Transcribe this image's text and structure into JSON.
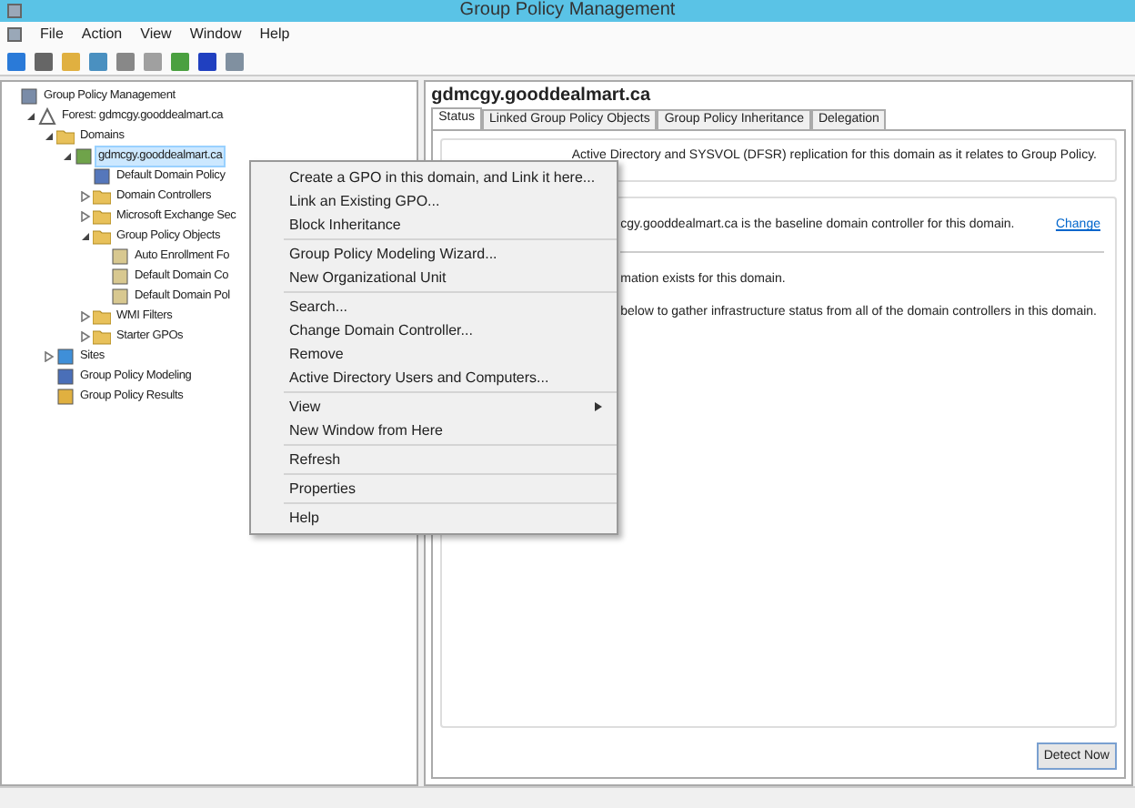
{
  "window": {
    "title": "Group Policy Management"
  },
  "menu_bar": [
    "File",
    "Action",
    "View",
    "Window",
    "Help"
  ],
  "tree": [
    {
      "label": "Group Policy Management",
      "kind": "root",
      "children": [
        {
          "label": "Forest: gdmcgy.gooddealmart.ca",
          "kind": "forest",
          "expanded": true,
          "children": [
            {
              "label": "Domains",
              "kind": "folder",
              "expanded": true,
              "children": [
                {
                  "label": "gdmcgy.gooddealmart.ca",
                  "kind": "domain",
                  "expanded": true,
                  "selected": true,
                  "children": [
                    {
                      "label": "Default Domain Policy",
                      "kind": "link",
                      "selected": false
                    },
                    {
                      "label": "Domain Controllers",
                      "kind": "folder",
                      "expanded": false,
                      "selected": false
                    },
                    {
                      "label": "Microsoft Exchange Sec",
                      "kind": "folder",
                      "expanded": false,
                      "selected": false
                    },
                    {
                      "label": "Group Policy Objects",
                      "kind": "folder",
                      "expanded": true,
                      "selected": false,
                      "children": [
                        {
                          "label": "Auto Enrollment Fo",
                          "kind": "gpo",
                          "selected": false
                        },
                        {
                          "label": "Default Domain Co",
                          "kind": "gpo",
                          "selected": false
                        },
                        {
                          "label": "Default Domain Pol",
                          "kind": "gpo",
                          "selected": false
                        }
                      ]
                    },
                    {
                      "label": "WMI Filters",
                      "kind": "folder",
                      "expanded": false,
                      "selected": false
                    },
                    {
                      "label": "Starter GPOs",
                      "kind": "folder",
                      "expanded": false,
                      "selected": false
                    }
                  ]
                }
              ]
            },
            {
              "label": "Sites",
              "kind": "sites",
              "expanded": false
            },
            {
              "label": "Group Policy Modeling",
              "kind": "modeling"
            },
            {
              "label": "Group Policy Results",
              "kind": "results"
            }
          ]
        }
      ]
    }
  ],
  "details": {
    "title": "gdmcgy.gooddealmart.ca",
    "tabs": [
      {
        "label": "Status",
        "selected": true
      },
      {
        "label": "Linked Group Policy Objects",
        "selected": false
      },
      {
        "label": "Group Policy Inheritance",
        "selected": false
      },
      {
        "label": "Delegation",
        "selected": false
      }
    ],
    "intro": "Active Directory and SYSVOL (DFSR) replication for this domain as it relates to Group Policy.",
    "baseline": "cgy.gooddealmart.ca is the baseline domain controller for this domain.",
    "change_link": "Change",
    "lines": [
      "mation exists for this domain.",
      "below to gather infrastructure status from all of the domain controllers in this domain."
    ],
    "detect_button": "Detect Now"
  },
  "context_menu": [
    [
      {
        "label": "Create a GPO in this domain, and Link it here..."
      },
      {
        "label": "Link an Existing GPO..."
      },
      {
        "label": "Block Inheritance"
      }
    ],
    [
      {
        "label": "Group Policy Modeling Wizard..."
      },
      {
        "label": "New Organizational Unit"
      }
    ],
    [
      {
        "label": "Search..."
      },
      {
        "label": "Change Domain Controller..."
      },
      {
        "label": "Remove"
      },
      {
        "label": "Active Directory Users and Computers..."
      }
    ],
    [
      {
        "label": "View",
        "submenu": true
      },
      {
        "label": "New Window from Here"
      }
    ],
    [
      {
        "label": "Refresh"
      }
    ],
    [
      {
        "label": "Properties"
      }
    ],
    [
      {
        "label": "Help"
      }
    ]
  ]
}
